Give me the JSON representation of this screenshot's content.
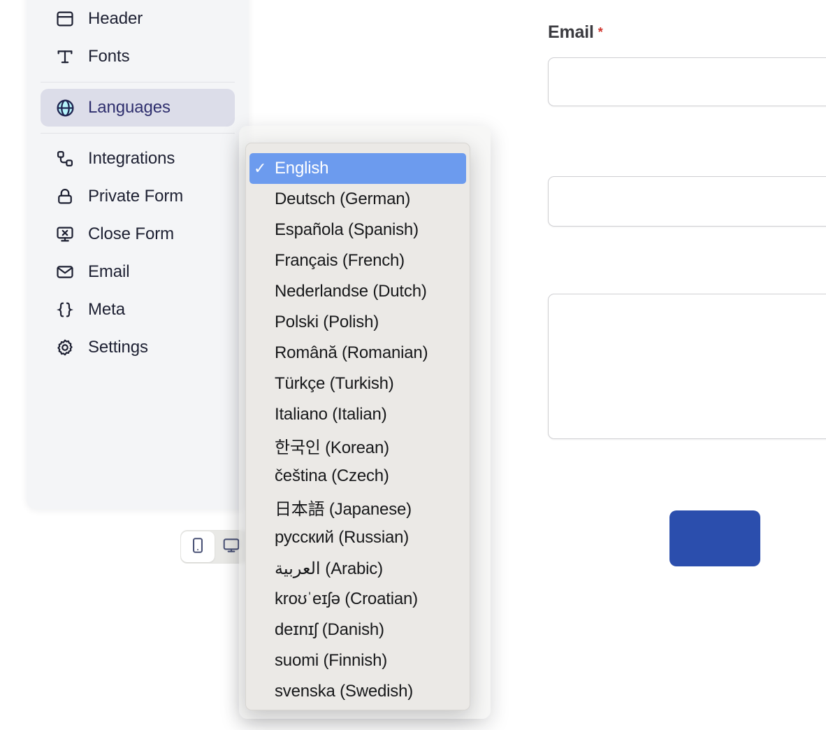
{
  "form": {
    "email_label": "Email",
    "required_marker": "*",
    "email_value": "",
    "email_placeholder": "",
    "field_two_value": "",
    "field_three_value": "",
    "submit_label": ""
  },
  "sidebar": {
    "items": [
      {
        "label": "Header",
        "icon": "header-icon",
        "active": false
      },
      {
        "label": "Fonts",
        "icon": "fonts-icon",
        "active": false
      },
      {
        "label": "Languages",
        "icon": "globe-icon",
        "active": true
      },
      {
        "label": "Integrations",
        "icon": "integrations-icon",
        "active": false
      },
      {
        "label": "Private Form",
        "icon": "lock-icon",
        "active": false
      },
      {
        "label": "Close Form",
        "icon": "monitor-x-icon",
        "active": false
      },
      {
        "label": "Email",
        "icon": "envelope-icon",
        "active": false
      },
      {
        "label": "Meta",
        "icon": "braces-icon",
        "active": false
      },
      {
        "label": "Settings",
        "icon": "gear-icon",
        "active": false
      }
    ]
  },
  "device_toggle": {
    "options": [
      {
        "name": "mobile-view",
        "icon": "mobile-icon",
        "selected": true
      },
      {
        "name": "desktop-view",
        "icon": "desktop-icon",
        "selected": false
      }
    ]
  },
  "language_dropdown": {
    "selected": "English",
    "check_glyph": "✓",
    "options": [
      "English",
      "Deutsch (German)",
      "Española (Spanish)",
      "Français (French)",
      "Nederlandse (Dutch)",
      "Polski (Polish)",
      "Română (Romanian)",
      "Türkçe (Turkish)",
      "Italiano (Italian)",
      "한국인 (Korean)",
      "čeština (Czech)",
      "日本語 (Japanese)",
      "русский (Russian)",
      "العربية (Arabic)",
      "kroʊˈeɪʃə (Croatian)",
      "deɪnɪʃ (Danish)",
      "suomi (Finnish)",
      "svenska (Swedish)"
    ]
  },
  "colors": {
    "accent_blue": "#2b4ead",
    "highlight_blue": "#6c9bee",
    "sidebar_bg": "#f4f5f7",
    "active_item_bg": "#dcdde9",
    "menu_bg": "#ebe9e6",
    "required_red": "#d0342c",
    "globe_fill": "#b6f4fb"
  }
}
